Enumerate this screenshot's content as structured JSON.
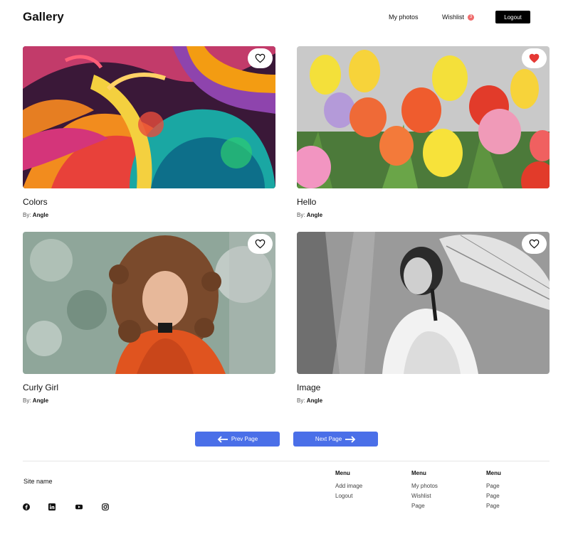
{
  "header": {
    "brand": "Gallery",
    "nav_my_photos": "My photos",
    "nav_wishlist": "Wishlist",
    "wishlist_count": "3",
    "logout": "Logout"
  },
  "cards": [
    {
      "title": "Colors",
      "by_label": "By:",
      "author": "Angle",
      "liked": false
    },
    {
      "title": "Hello",
      "by_label": "By:",
      "author": "Angle",
      "liked": true
    },
    {
      "title": "Curly Girl",
      "by_label": "By:",
      "author": "Angle",
      "liked": false
    },
    {
      "title": "Image",
      "by_label": "By:",
      "author": "Angle",
      "liked": false
    }
  ],
  "pagination": {
    "prev": "Prev Page",
    "next": "Next Page"
  },
  "footer": {
    "site_name": "Site name",
    "social_icons": [
      "facebook-icon",
      "linkedin-icon",
      "youtube-icon",
      "instagram-icon"
    ],
    "columns": [
      {
        "title": "Menu",
        "items": [
          "Add image",
          "Logout"
        ]
      },
      {
        "title": "Menu",
        "items": [
          "My photos",
          "Wishlist",
          "Page"
        ]
      },
      {
        "title": "Menu",
        "items": [
          "Page",
          "Page",
          "Page"
        ]
      }
    ]
  },
  "colors": {
    "accent": "#4a6fe8",
    "heart_active": "#e53935",
    "badge": "#ef6b6b"
  }
}
